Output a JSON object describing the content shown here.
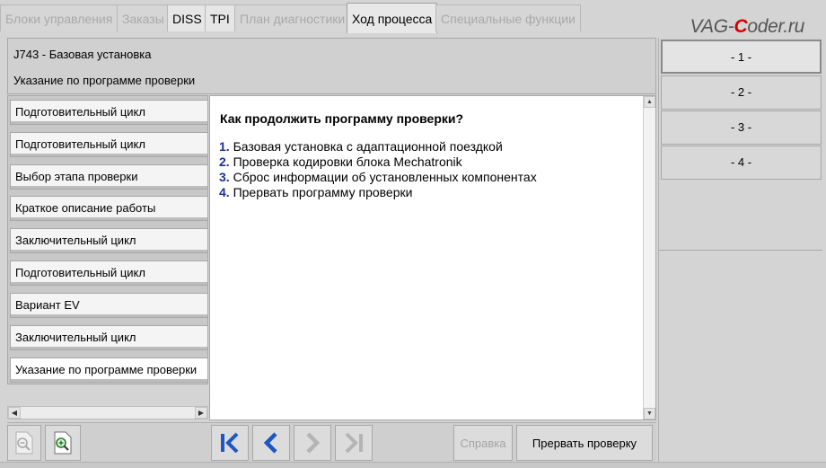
{
  "tabs": [
    {
      "label": "Блоки управления",
      "state": "disabled"
    },
    {
      "label": "Заказы",
      "state": "disabled"
    },
    {
      "label": "DISS",
      "state": "enabled"
    },
    {
      "label": "TPI",
      "state": "enabled"
    },
    {
      "label": "План диагностики",
      "state": "disabled"
    },
    {
      "label": "Ход процесса",
      "state": "active"
    },
    {
      "label": "Специальные функции",
      "state": "disabled"
    }
  ],
  "watermark": {
    "prefix": "VAG-",
    "c": "C",
    "suffix": "oder.ru"
  },
  "header": {
    "title": "J743 - Базовая установка",
    "subtitle": "Указание по программе проверки"
  },
  "steps": [
    "Подготовительный цикл",
    "Подготовительный цикл",
    "Выбор этапа проверки",
    "Краткое описание работы",
    "Заключительный цикл",
    "Подготовительный цикл",
    "Вариант EV",
    "Заключительный цикл",
    "Указание по программе проверки"
  ],
  "content": {
    "question": "Как продолжить программу проверки?",
    "options": [
      {
        "num": "1.",
        "text": " Базовая установка с адаптационной поездкой"
      },
      {
        "num": "2.",
        "text": " Проверка кодировки блока Mechatronik"
      },
      {
        "num": "3.",
        "text": " Сброс информации об установленных компонентах"
      },
      {
        "num": "4.",
        "text": " Прервать программу проверки"
      }
    ]
  },
  "choice_buttons": [
    "- 1 -",
    "- 2 -",
    "- 3 -",
    "- 4 -"
  ],
  "toolbar": {
    "help_label": "Справка",
    "abort_label": "Прервать проверку"
  },
  "colors": {
    "accent_number": "#1a2fa0",
    "nav_arrow_active": "#1e56c8",
    "nav_arrow_disabled": "#b4b4b4",
    "watermark_c": "#d40000"
  },
  "icons": {
    "zoom_out": "zoom-out-icon",
    "zoom_in": "zoom-in-icon",
    "first": "first-step-icon",
    "prev": "previous-step-icon",
    "next": "next-step-icon",
    "last": "last-step-icon"
  }
}
